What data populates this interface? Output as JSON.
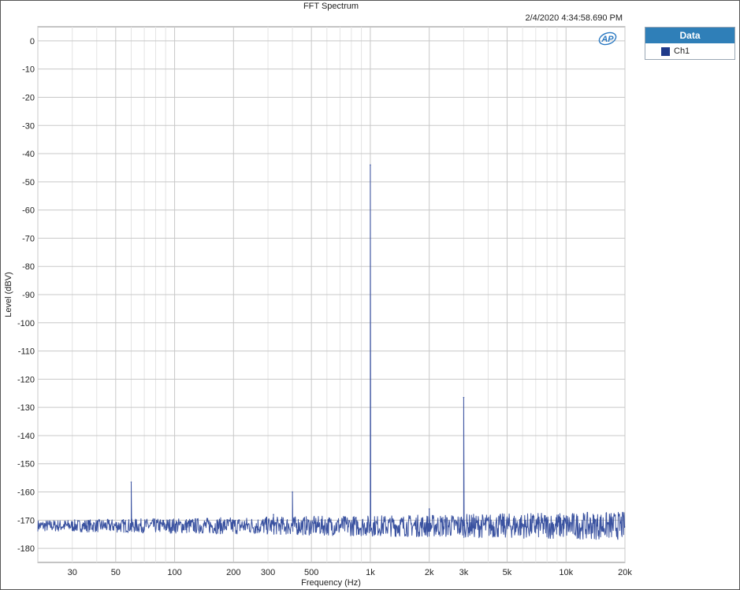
{
  "chart_data": {
    "type": "line",
    "title": "FFT Spectrum",
    "timestamp": "2/4/2020 4:34:58.690 PM",
    "xlabel": "Frequency (Hz)",
    "ylabel": "Level (dBV)",
    "xscale": "log",
    "xlim": [
      20,
      20000
    ],
    "ylim": [
      -185,
      5
    ],
    "grid": true,
    "x_ticks": [
      {
        "value": 30,
        "label": "30"
      },
      {
        "value": 50,
        "label": "50"
      },
      {
        "value": 100,
        "label": "100"
      },
      {
        "value": 200,
        "label": "200"
      },
      {
        "value": 300,
        "label": "300"
      },
      {
        "value": 500,
        "label": "500"
      },
      {
        "value": 1000,
        "label": "1k"
      },
      {
        "value": 2000,
        "label": "2k"
      },
      {
        "value": 3000,
        "label": "3k"
      },
      {
        "value": 5000,
        "label": "5k"
      },
      {
        "value": 10000,
        "label": "10k"
      },
      {
        "value": 20000,
        "label": "20k"
      }
    ],
    "y_ticks": [
      0,
      -10,
      -20,
      -30,
      -40,
      -50,
      -60,
      -70,
      -80,
      -90,
      -100,
      -110,
      -120,
      -130,
      -140,
      -150,
      -160,
      -170,
      -180
    ],
    "legend": {
      "title": "Data",
      "position": "right-top"
    },
    "series": [
      {
        "name": "Ch1",
        "color": "#3a52a0",
        "noise_floor_db": -172,
        "peaks": [
          {
            "x": 60,
            "y": -156.5
          },
          {
            "x": 320,
            "y": -168
          },
          {
            "x": 400,
            "y": -160
          },
          {
            "x": 1000,
            "y": -44
          },
          {
            "x": 2000,
            "y": -166
          },
          {
            "x": 3000,
            "y": -126.5
          }
        ]
      }
    ]
  },
  "legend_box": {
    "title": "Data",
    "swatch_color": "#1f3a8a"
  },
  "logo": {
    "text": "AP",
    "color": "#2b79c2"
  }
}
